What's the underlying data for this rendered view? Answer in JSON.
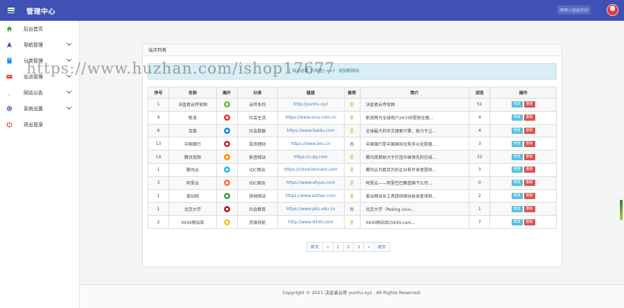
{
  "header": {
    "title": "管理中心",
    "right_text": "嘿嘿小姐姐你好"
  },
  "sidebar": {
    "items": [
      {
        "label": "后台首页",
        "icon": "home-icon",
        "color": "#43a047",
        "dropdown": false
      },
      {
        "label": "导航管理",
        "icon": "navigation-icon",
        "color": "#5e35b1",
        "dropdown": true
      },
      {
        "label": "分类管理",
        "icon": "book-icon",
        "color": "#1e88e5",
        "dropdown": true
      },
      {
        "label": "站点管理",
        "icon": "tray-icon",
        "color": "#e53935",
        "dropdown": true
      },
      {
        "label": "网站公告",
        "icon": "bell-icon",
        "color": "#fb8c00",
        "dropdown": true
      },
      {
        "label": "系统设置",
        "icon": "gear-icon",
        "color": "#3949ab",
        "dropdown": true
      },
      {
        "label": "退出登录",
        "icon": "power-icon",
        "color": "#e53935",
        "dropdown": false
      }
    ]
  },
  "watermark": "https://www.huzhan.com/ishop17677",
  "card": {
    "title": "站点列表",
    "notice": "[ 站点总数 ] (检查) ==》 添加新网站"
  },
  "table": {
    "headers": [
      "序号",
      "名称",
      "图片",
      "分类",
      "链接",
      "推荐",
      "简介",
      "浏览",
      "操作"
    ],
    "rows": [
      {
        "id": "1",
        "name": "决蓝者云呼官网",
        "logo_color": "#7cb342",
        "category": "云呼系列",
        "url": "http://yunhu.xyz",
        "recommend": "是",
        "desc": "决蓝者云呼官网",
        "views": "51"
      },
      {
        "id": "4",
        "name": "新浪",
        "logo_color": "#e53935",
        "category": "社会生活",
        "url": "https://www.sina.com.cn",
        "recommend": "是",
        "desc": "新浪网为全球用户24小时提供全面...",
        "views": "4"
      },
      {
        "id": "6",
        "name": "百度",
        "logo_color": "#1e88e5",
        "category": "社会数据",
        "url": "https://www.baidu.com",
        "recommend": "是",
        "desc": "全球最大的中文搜索引擎、致力于让...",
        "views": "4"
      },
      {
        "id": "13",
        "name": "中国银行",
        "logo_color": "#c62828",
        "category": "投资理财",
        "url": "https://www.boc.cn",
        "recommend": "否",
        "desc": "中国银行是中国国际化和多元化程度...",
        "views": "3"
      },
      {
        "id": "14",
        "name": "腾讯视频",
        "logo_color": "#fb8c00",
        "category": "影音网站",
        "url": "https://v.qq.com",
        "recommend": "是",
        "desc": "腾讯视频致力于打造中国领先的在线...",
        "views": "22"
      },
      {
        "id": "1",
        "name": "腾讯云",
        "logo_color": "#29b6f6",
        "category": "IDC网站",
        "url": "https://cloud.tencent.com",
        "recommend": "是",
        "desc": "腾讯云为数百万的企业和开发者提供...",
        "views": "3"
      },
      {
        "id": "3",
        "name": "阿里云",
        "logo_color": "#ff7043",
        "category": "IDC网站",
        "url": "https://www.aliyun.com",
        "recommend": "是",
        "desc": "阿里云——阿里巴巴集团旗下公司...",
        "views": "0"
      },
      {
        "id": "1",
        "name": "爱站网",
        "logo_color": "#43a047",
        "category": "其他网站",
        "url": "https://www.aizhan.com",
        "recommend": "是",
        "desc": "爱站网站长工具提供网站收录查询和...",
        "views": "2"
      },
      {
        "id": "1",
        "name": "北京大学",
        "logo_color": "#b71c1c",
        "category": "社会教育",
        "url": "https://www.pku.edu.cn",
        "recommend": "否",
        "desc": "北京大学（Peking Univ...",
        "views": "1"
      },
      {
        "id": "2",
        "name": "0430网站库",
        "logo_color": "#fbc02d",
        "category": "资源导航",
        "url": "http://www.0430.com",
        "recommend": "是",
        "desc": "0430网站库(0430.com...",
        "views": "7"
      }
    ],
    "edit_label": "修改",
    "delete_label": "删除"
  },
  "pagination": {
    "items": [
      "首页",
      "«",
      "1",
      "2",
      "3",
      "»",
      "尾页"
    ]
  },
  "footer": {
    "text": "Copyright © 2021 决蓝者云呼 yunhu.xyz . All Rights Reserved."
  }
}
